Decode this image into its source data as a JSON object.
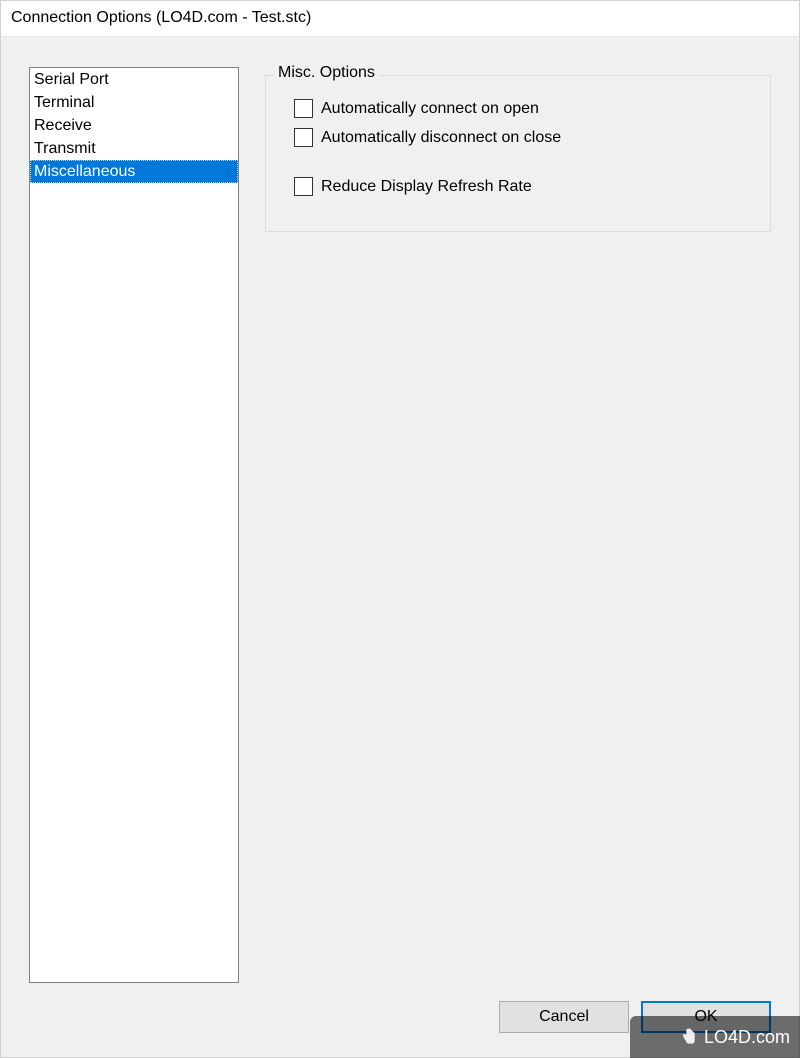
{
  "window": {
    "title": "Connection Options (LO4D.com - Test.stc)"
  },
  "nav": {
    "items": [
      {
        "label": "Serial Port",
        "selected": false
      },
      {
        "label": "Terminal",
        "selected": false
      },
      {
        "label": "Receive",
        "selected": false
      },
      {
        "label": "Transmit",
        "selected": false
      },
      {
        "label": "Miscellaneous",
        "selected": true
      }
    ]
  },
  "group": {
    "legend": "Misc. Options",
    "checkboxes": [
      {
        "label": "Automatically connect on open",
        "checked": false
      },
      {
        "label": "Automatically disconnect on close",
        "checked": false
      },
      {
        "label": "Reduce Display Refresh Rate",
        "checked": false
      }
    ]
  },
  "buttons": {
    "cancel": "Cancel",
    "ok": "OK"
  },
  "watermark": {
    "text": "LO4D.com"
  }
}
